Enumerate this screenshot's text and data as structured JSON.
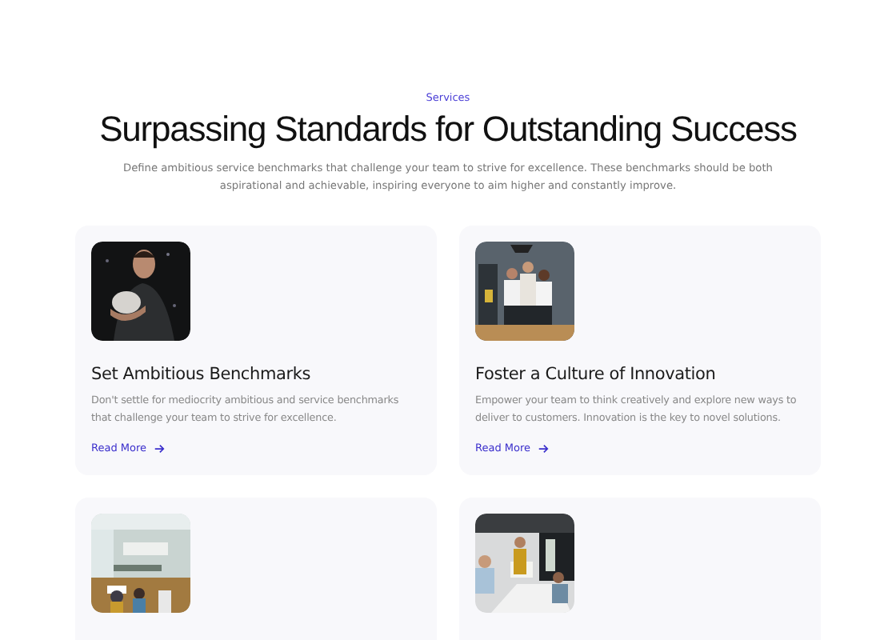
{
  "eyebrow": "Services",
  "heading": "Surpassing Standards for Outstanding Success",
  "intro": "Define ambitious service benchmarks that challenge your team to strive for excellence. These benchmarks should be both aspirational and achievable, inspiring everyone to aim higher and constantly improve.",
  "cards": [
    {
      "picture": {
        "kind": "picture"
      },
      "title": "Set Ambitious Benchmarks",
      "text": "Don't settle for mediocrity ambitious and service benchmarks that challenge your team to strive for excellence.",
      "link": "Read More"
    },
    {
      "picture": {
        "kind": "picture"
      },
      "title": "Foster a Culture of Innovation",
      "text": "Empower your team to think creatively and explore new ways to deliver to customers. Innovation is the key to novel solutions.",
      "link": "Read More"
    },
    {
      "picture": {
        "kind": "picture"
      }
    },
    {
      "picture": {
        "kind": "picture"
      }
    }
  ]
}
